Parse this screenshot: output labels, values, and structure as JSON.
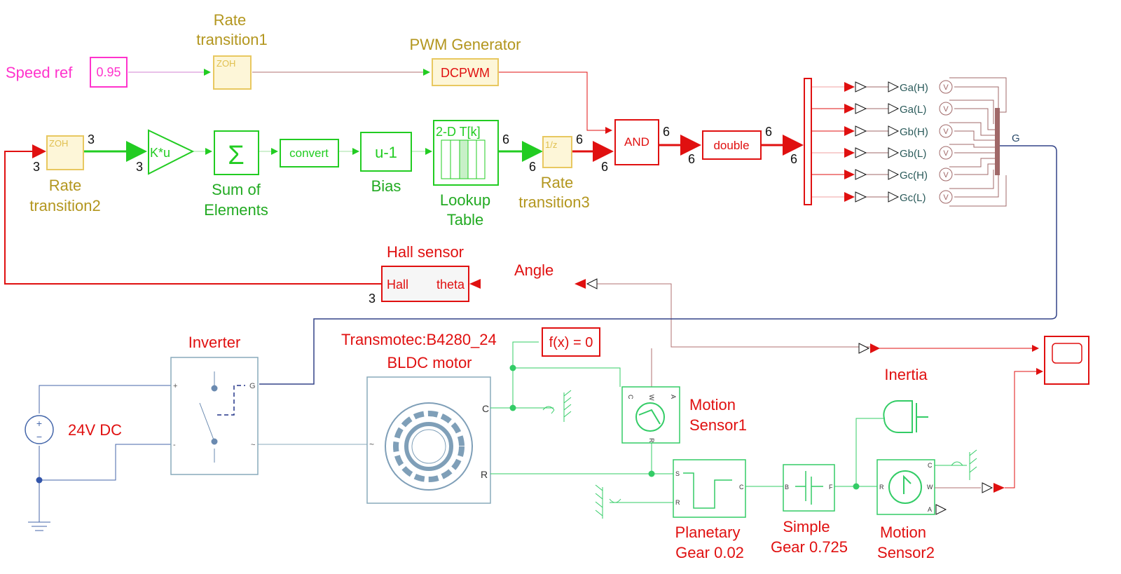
{
  "colors": {
    "signal_red": "#e01010",
    "signal_green": "#22cc22",
    "rate_yellow": "#e8c860",
    "speed_magenta": "#ff33cc",
    "gate_bus": "#334488",
    "simscape_blue": "#7f9fb8",
    "mech_green": "#33cc66",
    "goto_brown": "#a06868"
  },
  "speed_ref": {
    "label": "Speed ref",
    "value": "0.95"
  },
  "rate_transition1": {
    "label_line1": "Rate",
    "label_line2": "transition1",
    "icon": "ZOH"
  },
  "pwm": {
    "label": "PWM Generator",
    "block_text": "DCPWM"
  },
  "rate_transition2": {
    "label_line1": "Rate",
    "label_line2": "transition2",
    "icon": "ZOH",
    "in_dim": "3",
    "out_dim": "3"
  },
  "gain": {
    "text": "K*u",
    "dim": "3"
  },
  "sum": {
    "label_line1": "Sum of",
    "label_line2": "Elements",
    "icon": "Σ"
  },
  "convert": {
    "text": "convert"
  },
  "bias": {
    "text": "u-1",
    "label": "Bias"
  },
  "lookup": {
    "text": "2-D T[k]",
    "label_line1": "Lookup",
    "label_line2": "Table",
    "dim": "6"
  },
  "rate_transition3": {
    "label_line1": "Rate",
    "label_line2": "transition3",
    "icon": "1/z",
    "in_dim": "6",
    "out_dim": "6"
  },
  "and_block": {
    "text": "AND",
    "in_dim": "6",
    "out_dim": "6"
  },
  "double_block": {
    "text": "double",
    "in_dim": "6",
    "out_dim": "6"
  },
  "demux": {
    "in_dim": "6"
  },
  "gates": [
    "Ga(H)",
    "Ga(L)",
    "Gb(H)",
    "Gb(L)",
    "Gc(H)",
    "Gc(L)"
  ],
  "gate_bus_label": "G",
  "hall": {
    "label": "Hall sensor",
    "in_port": "theta",
    "out_port": "Hall",
    "dim": "3",
    "angle_label": "Angle"
  },
  "inverter": {
    "label": "Inverter",
    "port_plus": "+",
    "port_minus": "-",
    "port_g": "G",
    "port_ac": "~"
  },
  "dc_source": {
    "label": "24V DC"
  },
  "motor": {
    "label_line1": "Transmotec:B4280_24",
    "label_line2": "BLDC motor",
    "port_c": "C",
    "port_r": "R",
    "port_ac": "~"
  },
  "solver": {
    "text": "f(x) = 0"
  },
  "motion_sensor1": {
    "label_line1": "Motion",
    "label_line2": "Sensor1",
    "ports": [
      "C",
      "W",
      "A",
      "R"
    ]
  },
  "planetary": {
    "label_line1": "Planetary",
    "label_line2": "Gear 0.02",
    "ports": [
      "S",
      "R",
      "C"
    ]
  },
  "simple_gear": {
    "label_line1": "Simple",
    "label_line2": "Gear 0.725",
    "ports": [
      "B",
      "F"
    ]
  },
  "inertia": {
    "label": "Inertia"
  },
  "motion_sensor2": {
    "label_line1": "Motion",
    "label_line2": "Sensor2",
    "ports": [
      "R",
      "C",
      "W",
      "A"
    ]
  }
}
